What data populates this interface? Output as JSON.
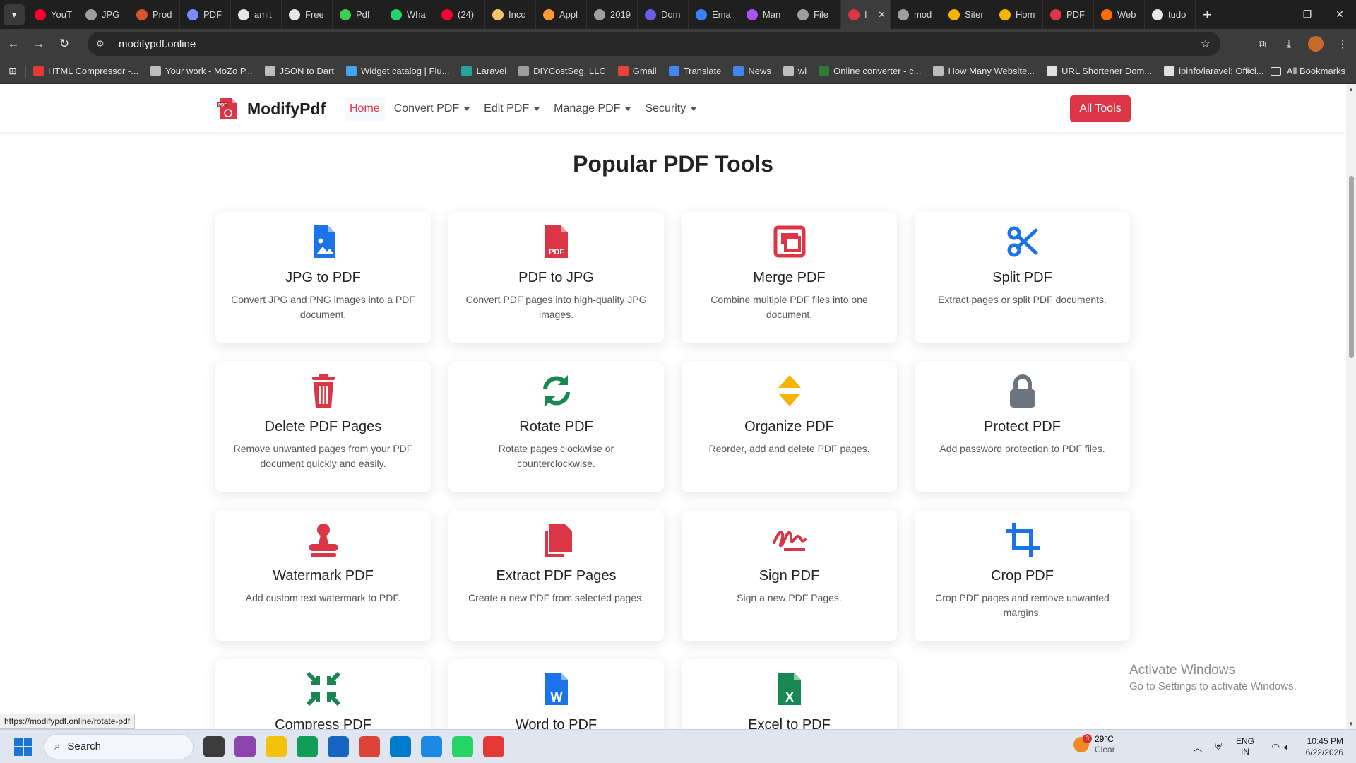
{
  "browser": {
    "tabs": [
      {
        "label": "YouT",
        "color": "#ff0033"
      },
      {
        "label": "JPG",
        "color": "#9e9e9e"
      },
      {
        "label": "Prod",
        "color": "#da552f"
      },
      {
        "label": "PDF",
        "color": "#7b8cff"
      },
      {
        "label": "amit",
        "color": "#e6e6e6"
      },
      {
        "label": "Free",
        "color": "#e6e6e6"
      },
      {
        "label": "Pdf",
        "color": "#3ccf4e"
      },
      {
        "label": "Wha",
        "color": "#25d366"
      },
      {
        "label": "(24)",
        "color": "#ff0033"
      },
      {
        "label": "Inco",
        "color": "#f2c36b"
      },
      {
        "label": "Appl",
        "color": "#ff9933"
      },
      {
        "label": "2019",
        "color": "#9e9e9e"
      },
      {
        "label": "Dom",
        "color": "#6c5ce7"
      },
      {
        "label": "Ema",
        "color": "#3b82f6"
      },
      {
        "label": "Man",
        "color": "#a855f7"
      },
      {
        "label": "File",
        "color": "#9e9e9e"
      },
      {
        "label": "I",
        "color": "#dc3545",
        "active": true
      },
      {
        "label": "mod",
        "color": "#9e9e9e"
      },
      {
        "label": "Siter",
        "color": "#f4b400"
      },
      {
        "label": "Hom",
        "color": "#f4b400"
      },
      {
        "label": "PDF",
        "color": "#dc3545"
      },
      {
        "label": "Web",
        "color": "#ff6d00"
      },
      {
        "label": "tudo",
        "color": "#e6e6e6"
      }
    ],
    "new_tab": "+",
    "address": "modifypdf.online",
    "bookmarks": [
      {
        "label": "HTML Compressor -...",
        "color": "#e53935"
      },
      {
        "label": "Your work - MoZo P...",
        "color": "#bdbdbd"
      },
      {
        "label": "JSON to Dart",
        "color": "#bdbdbd"
      },
      {
        "label": "Widget catalog | Flu...",
        "color": "#42a5f5"
      },
      {
        "label": "Laravel",
        "color": "#26a69a"
      },
      {
        "label": "DIYCostSeg, LLC",
        "color": "#9e9e9e"
      },
      {
        "label": "Gmail",
        "color": "#ea4335"
      },
      {
        "label": "Translate",
        "color": "#4285f4"
      },
      {
        "label": "News",
        "color": "#4285f4"
      },
      {
        "label": "wi",
        "color": "#bdbdbd"
      },
      {
        "label": "Online converter - c...",
        "color": "#2e7d32"
      },
      {
        "label": "How Many Website...",
        "color": "#bdbdbd"
      },
      {
        "label": "URL Shortener Dom...",
        "color": "#e0e0e0"
      },
      {
        "label": "ipinfo/laravel: Offici...",
        "color": "#e0e0e0"
      }
    ],
    "more_bookmarks": "»",
    "all_bookmarks": "All Bookmarks"
  },
  "site": {
    "brand": "ModifyPdf",
    "nav": [
      {
        "label": "Home",
        "dropdown": false
      },
      {
        "label": "Convert PDF",
        "dropdown": true
      },
      {
        "label": "Edit PDF",
        "dropdown": true
      },
      {
        "label": "Manage PDF",
        "dropdown": true
      },
      {
        "label": "Security",
        "dropdown": true
      }
    ],
    "all_tools": "All Tools",
    "heading": "Popular PDF Tools",
    "tools": [
      {
        "title": "JPG to PDF",
        "desc": "Convert JPG and PNG images into a PDF document.",
        "icon": "image-file-icon",
        "color": "#1a73e8"
      },
      {
        "title": "PDF to JPG",
        "desc": "Convert PDF pages into high-quality JPG images.",
        "icon": "pdf-file-icon",
        "color": "#dc3545"
      },
      {
        "title": "Merge PDF",
        "desc": "Combine multiple PDF files into one document.",
        "icon": "merge-icon",
        "color": "#dc3545"
      },
      {
        "title": "Split PDF",
        "desc": "Extract pages or split PDF documents.",
        "icon": "scissors-icon",
        "color": "#1a73e8"
      },
      {
        "title": "Delete PDF Pages",
        "desc": "Remove unwanted pages from your PDF document quickly and easily.",
        "icon": "trash-icon",
        "color": "#dc3545"
      },
      {
        "title": "Rotate PDF",
        "desc": "Rotate pages clockwise or counterclockwise.",
        "icon": "rotate-icon",
        "color": "#198754"
      },
      {
        "title": "Organize PDF",
        "desc": "Reorder, add and delete PDF pages.",
        "icon": "sort-icon",
        "color": "#f5b400"
      },
      {
        "title": "Protect PDF",
        "desc": "Add password protection to PDF files.",
        "icon": "lock-icon",
        "color": "#6c757d"
      },
      {
        "title": "Watermark PDF",
        "desc": "Add custom text watermark to PDF.",
        "icon": "stamp-icon",
        "color": "#dc3545"
      },
      {
        "title": "Extract PDF Pages",
        "desc": "Create a new PDF from selected pages.",
        "icon": "copy-icon",
        "color": "#dc3545"
      },
      {
        "title": "Sign PDF",
        "desc": "Sign a new PDF Pages.",
        "icon": "signature-icon",
        "color": "#dc3545"
      },
      {
        "title": "Crop PDF",
        "desc": "Crop PDF pages and remove unwanted margins.",
        "icon": "crop-icon",
        "color": "#1a73e8"
      },
      {
        "title": "Compress PDF",
        "desc": "",
        "icon": "compress-icon",
        "color": "#198754"
      },
      {
        "title": "Word to PDF",
        "desc": "",
        "icon": "word-file-icon",
        "color": "#1a73e8"
      },
      {
        "title": "Excel to PDF",
        "desc": "",
        "icon": "excel-file-icon",
        "color": "#198754"
      }
    ]
  },
  "overlay": {
    "activate_title": "Activate Windows",
    "activate_sub": "Go to Settings to activate Windows.",
    "status_url": "https://modifypdf.online/rotate-pdf"
  },
  "taskbar": {
    "search": "Search",
    "weather_temp": "29°C",
    "weather_cond": "Clear",
    "weather_badge": "3",
    "lang_1": "ENG",
    "lang_2": "IN",
    "time": "10:45 PM",
    "date": "6/22/2026",
    "apps": [
      "#3b3b3b",
      "#8e44ad",
      "#f4c20d",
      "#0f9d58",
      "#1565c0",
      "#db4437",
      "#007acc",
      "#1e88e5",
      "#25d366",
      "#e53935"
    ]
  }
}
